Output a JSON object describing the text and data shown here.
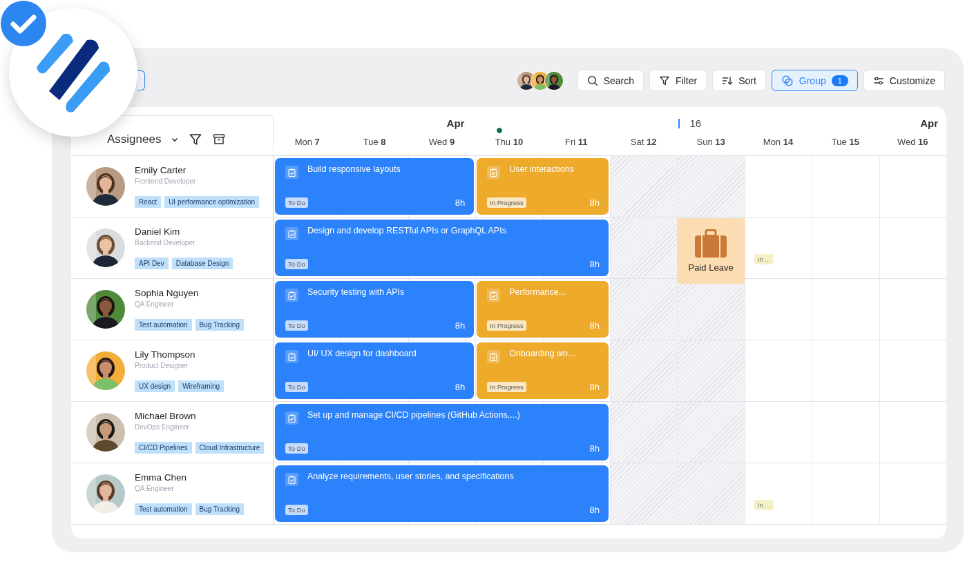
{
  "toolbar": {
    "buttons": [
      {
        "kind": "search",
        "label": "Search",
        "selected": false
      },
      {
        "kind": "filter",
        "label": "Filter",
        "selected": false
      },
      {
        "kind": "sort",
        "label": "Sort",
        "selected": false
      },
      {
        "kind": "group",
        "label": "Group",
        "count": "1",
        "selected": true
      },
      {
        "kind": "customize",
        "label": "Customize",
        "selected": false
      }
    ]
  },
  "assignees_header": {
    "label": "Assignees"
  },
  "timeline_header": {
    "month": "Apr",
    "marker_label": "16",
    "end_month": "Apr",
    "days": [
      {
        "label": "Mon **7**",
        "today": false,
        "weekend": false
      },
      {
        "label": "Tue **8**",
        "today": false,
        "weekend": false
      },
      {
        "label": "Wed **9**",
        "today": false,
        "weekend": false
      },
      {
        "label": "Thu **10**",
        "today": true,
        "weekend": false
      },
      {
        "label": "Fri **11**",
        "today": false,
        "weekend": false
      },
      {
        "label": "Sat **12**",
        "today": false,
        "weekend": true
      },
      {
        "label": "Sun **13**",
        "today": false,
        "weekend": true
      },
      {
        "label": "Mon **14**",
        "today": false,
        "weekend": false
      },
      {
        "label": "Tue **15**",
        "today": false,
        "weekend": false
      },
      {
        "label": "Wed **16**",
        "today": false,
        "weekend": false
      }
    ]
  },
  "rows": [
    {
      "name": "Emily Carter",
      "role": "Frontend Developer",
      "tags": [
        "React",
        "UI performance optimization"
      ],
      "slots": [
        {
          "kind": "task",
          "title": "Build responsive layouts",
          "status": "To Do",
          "hours": "8h",
          "color": "#2b82fb"
        },
        {
          "kind": "continued"
        },
        {
          "kind": "continued"
        },
        {
          "kind": "task",
          "title": "User interactions",
          "status": "In Progress",
          "hours": "8h",
          "color": "#eeaa2b"
        },
        {
          "kind": "continued"
        },
        {
          "kind": "empty"
        },
        {
          "kind": "empty"
        },
        {
          "kind": "empty"
        },
        {
          "kind": "empty"
        },
        {
          "kind": "empty"
        }
      ]
    },
    {
      "name": "Daniel Kim",
      "role": "Backend Developer",
      "tags": [
        "API Dev",
        "Database Design"
      ],
      "slots": [
        {
          "kind": "task",
          "title": "Design and develop RESTful APIs or GraphQL APIs",
          "status": "To Do",
          "hours": "8h",
          "color": "#2b82fb"
        },
        {
          "kind": "continued"
        },
        {
          "kind": "continued"
        },
        {
          "kind": "continued"
        },
        {
          "kind": "continued"
        },
        {
          "kind": "empty"
        },
        {
          "kind": "leave",
          "title": "Paid Leave"
        },
        {
          "kind": "chip",
          "title": "In ..."
        },
        {
          "kind": "empty"
        },
        {
          "kind": "empty"
        }
      ]
    },
    {
      "name": "Sophia Nguyen",
      "role": "QA Engineer",
      "tags": [
        "Test automation",
        "Bug Tracking"
      ],
      "slots": [
        {
          "kind": "task",
          "title": "Security testing with APIs",
          "status": "To Do",
          "hours": "8h",
          "color": "#2b82fb"
        },
        {
          "kind": "continued"
        },
        {
          "kind": "continued"
        },
        {
          "kind": "task",
          "title": "Performance...",
          "status": "In Progress",
          "hours": "8h",
          "color": "#eeaa2b"
        },
        {
          "kind": "continued"
        },
        {
          "kind": "empty"
        },
        {
          "kind": "empty"
        },
        {
          "kind": "empty"
        },
        {
          "kind": "empty"
        },
        {
          "kind": "empty"
        }
      ]
    },
    {
      "name": "Lily Thompson",
      "role": "Product Designer",
      "tags": [
        "UX design",
        "Wireframing"
      ],
      "slots": [
        {
          "kind": "task",
          "title": "UI/ UX design for dashboard",
          "status": "To Do",
          "hours": "8h",
          "color": "#2b82fb"
        },
        {
          "kind": "continued"
        },
        {
          "kind": "continued"
        },
        {
          "kind": "task",
          "title": "Onboarding wo...",
          "status": "In Progress",
          "hours": "8h",
          "color": "#eeaa2b"
        },
        {
          "kind": "continued"
        },
        {
          "kind": "empty"
        },
        {
          "kind": "empty"
        },
        {
          "kind": "empty"
        },
        {
          "kind": "empty"
        },
        {
          "kind": "empty"
        }
      ]
    },
    {
      "name": "Michael Brown",
      "role": "DevOps Engineer",
      "tags": [
        "CI/CD Pipelines",
        "Cloud Infrastructure"
      ],
      "slots": [
        {
          "kind": "task",
          "title": "Set up and manage CI/CD pipelines (GitHub Actions,...)",
          "status": "To Do",
          "hours": "8h",
          "color": "#2b82fb"
        },
        {
          "kind": "continued"
        },
        {
          "kind": "continued"
        },
        {
          "kind": "continued"
        },
        {
          "kind": "continued"
        },
        {
          "kind": "empty"
        },
        {
          "kind": "empty"
        },
        {
          "kind": "empty"
        },
        {
          "kind": "empty"
        },
        {
          "kind": "empty"
        }
      ]
    },
    {
      "name": "Emma Chen",
      "role": "QA Engineer",
      "tags": [
        "Test automation",
        "Bug Tracking"
      ],
      "slots": [
        {
          "kind": "task",
          "title": "Analyze requirements, user stories, and specifications",
          "status": "To Do",
          "hours": "8h",
          "color": "#2b82fb"
        },
        {
          "kind": "continued"
        },
        {
          "kind": "continued"
        },
        {
          "kind": "continued"
        },
        {
          "kind": "continued"
        },
        {
          "kind": "empty"
        },
        {
          "kind": "empty"
        },
        {
          "kind": "chip",
          "title": "In ..."
        },
        {
          "kind": "empty"
        },
        {
          "kind": "empty"
        }
      ]
    }
  ]
}
